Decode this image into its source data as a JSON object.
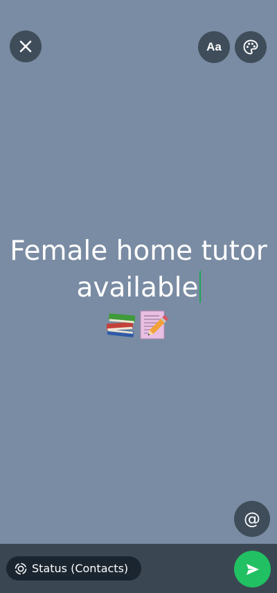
{
  "toolbar": {
    "close_icon": "close-icon",
    "font_button_label": "Aa",
    "palette_icon": "palette-icon"
  },
  "status": {
    "text_line1": "Female home tutor",
    "text_line2": "available",
    "emoji_icons": [
      "books-emoji-icon",
      "memo-pencil-emoji-icon"
    ],
    "background_color": "#7a8ca3"
  },
  "mention": {
    "label": "@"
  },
  "footer": {
    "audience_label": "Status (Contacts)",
    "audience_icon": "status-ring-icon",
    "send_icon": "send-icon",
    "send_color": "#21c063"
  }
}
